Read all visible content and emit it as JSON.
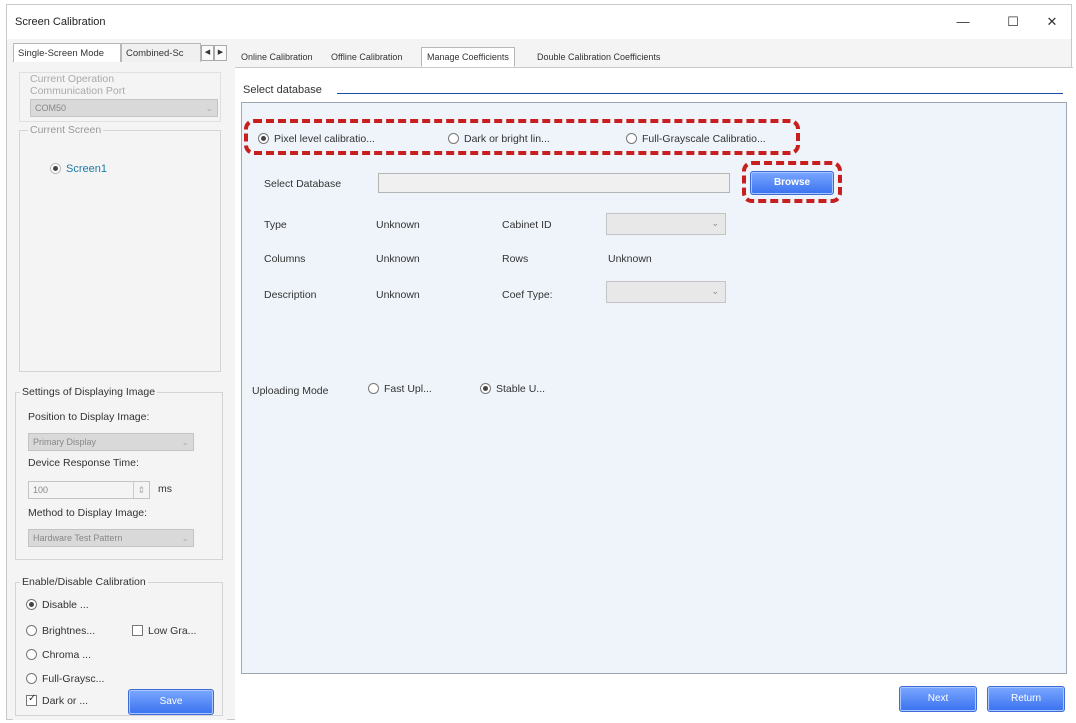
{
  "window": {
    "title": "Screen Calibration",
    "controls": {
      "minimize": "—",
      "maximize": "☐",
      "close": "✕"
    }
  },
  "left_tabs": {
    "tab1": "Single-Screen Mode",
    "tab2": "Combined-Sc",
    "prev_arrow": "◀",
    "next_arrow": "▶"
  },
  "left": {
    "current_operation_label": "Current Operation",
    "communication_port_label": "Communication Port",
    "communication_port_value": "COM50",
    "current_screen_title": "Current Screen",
    "screen_item": "Screen1",
    "display_settings_title": "Settings of Displaying Image",
    "position_label": "Position to Display Image:",
    "position_value": "Primary Display",
    "response_time_label": "Device Response Time:",
    "response_time_value": "100",
    "response_time_unit": "ms",
    "method_label": "Method to Display Image:",
    "method_value": "Hardware Test Pattern",
    "enable_title": "Enable/Disable Calibration",
    "opt_disable": "Disable ...",
    "opt_brightness": "Brightnes...",
    "opt_low_gray": "Low Gra...",
    "opt_chroma": "Chroma ...",
    "opt_full_gray": "Full-Graysc...",
    "opt_dark": "Dark or ...",
    "save_button": "Save"
  },
  "main_tabs": {
    "online": "Online Calibration",
    "offline": "Offline Calibration",
    "manage": "Manage Coefficients",
    "double": "Double Calibration Coefficients"
  },
  "main": {
    "select_database_title": "Select database",
    "radio_pixel": "Pixel level calibratio...",
    "radio_dark": "Dark or bright lin...",
    "radio_full": "Full-Grayscale Calibratio...",
    "select_database_label": "Select Database",
    "browse_button": "Browse",
    "type_label": "Type",
    "type_value": "Unknown",
    "cabinet_id_label": "Cabinet ID",
    "columns_label": "Columns",
    "columns_value": "Unknown",
    "rows_label": "Rows",
    "rows_value": "Unknown",
    "description_label": "Description",
    "description_value": "Unknown",
    "coef_type_label": "Coef Type:",
    "uploading_mode_label": "Uploading Mode",
    "upload_fast": "Fast Upl...",
    "upload_stable": "Stable U...",
    "next_button": "Next",
    "return_button": "Return"
  },
  "colors": {
    "highlight": "#c81e1e",
    "button_blue": "#3a72f0",
    "panel_bg": "#eef4fa"
  }
}
